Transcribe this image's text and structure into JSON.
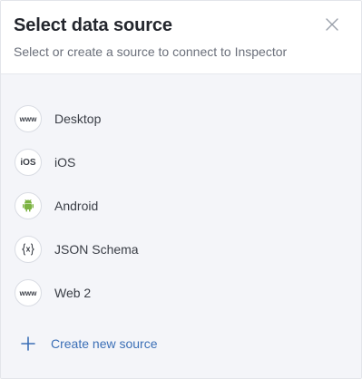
{
  "dialog": {
    "title": "Select data source",
    "subtitle": "Select or create a source to connect to Inspector",
    "close_icon": "close-icon"
  },
  "sources": [
    {
      "label": "Desktop",
      "icon": "www-icon",
      "icon_text": "www"
    },
    {
      "label": "iOS",
      "icon": "ios-icon",
      "icon_text": "iOS"
    },
    {
      "label": "Android",
      "icon": "android-icon",
      "icon_text": ""
    },
    {
      "label": "JSON Schema",
      "icon": "json-braces-icon",
      "icon_text": ""
    },
    {
      "label": "Web 2",
      "icon": "www-icon",
      "icon_text": "www"
    }
  ],
  "create": {
    "label": "Create new source",
    "icon": "plus-icon"
  },
  "colors": {
    "accent": "#3b6fb6",
    "android_green": "#7cb342",
    "body_bg": "#f4f5f9"
  }
}
